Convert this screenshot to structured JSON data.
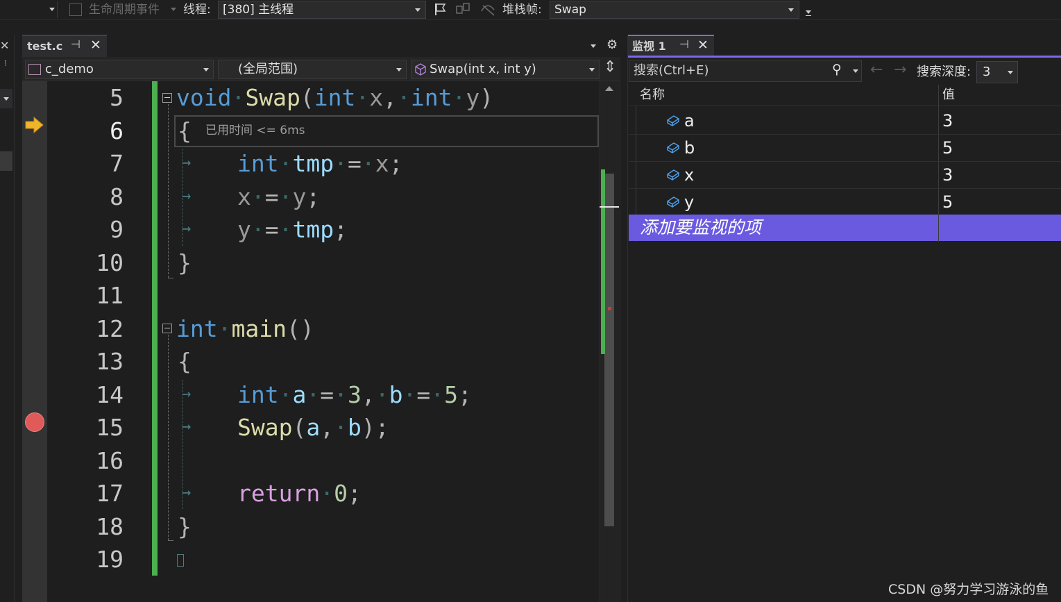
{
  "toolbar": {
    "lifecycle_label": "生命周期事件",
    "thread_label": "线程:",
    "thread_value": "[380] 主线程",
    "stackframe_label": "堆栈帧:",
    "stackframe_value": "Swap"
  },
  "editor": {
    "tab_title": "test.c",
    "project_combo": "c_demo",
    "scope_combo": "(全局范围)",
    "function_combo": "Swap(int x, int y)",
    "timing_hint": "已用时间 <= 6ms",
    "current_line": 6,
    "breakpoint_line": 15,
    "line_numbers": [
      "5",
      "6",
      "7",
      "8",
      "9",
      "10",
      "11",
      "12",
      "13",
      "14",
      "15",
      "16",
      "17",
      "18",
      "19"
    ],
    "lines": [
      "void·Swap(int·x,·int·y)",
      "{",
      "int·tmp·=·x;",
      "x·=·y;",
      "y·=·tmp;",
      "}",
      "",
      "int·main()",
      "{",
      "int·a·=·3,·b·=·5;",
      "Swap(a,·b);",
      "",
      "return·0;",
      "}",
      ""
    ]
  },
  "watch": {
    "tab_title": "监视 1",
    "search_placeholder": "搜索(Ctrl+E)",
    "search_depth_label": "搜索深度:",
    "search_depth_value": "3",
    "col_name": "名称",
    "col_value": "值",
    "rows": [
      {
        "name": "a",
        "value": "3"
      },
      {
        "name": "b",
        "value": "5"
      },
      {
        "name": "x",
        "value": "3"
      },
      {
        "name": "y",
        "value": "5"
      }
    ],
    "add_item": "添加要监视的项"
  },
  "watermark": "CSDN @努力学习游泳的鱼",
  "colors": {
    "accent": "#7b68ee",
    "change_bar": "#4caf50",
    "breakpoint": "#e05a5a",
    "current_arrow": "#f0b429"
  }
}
